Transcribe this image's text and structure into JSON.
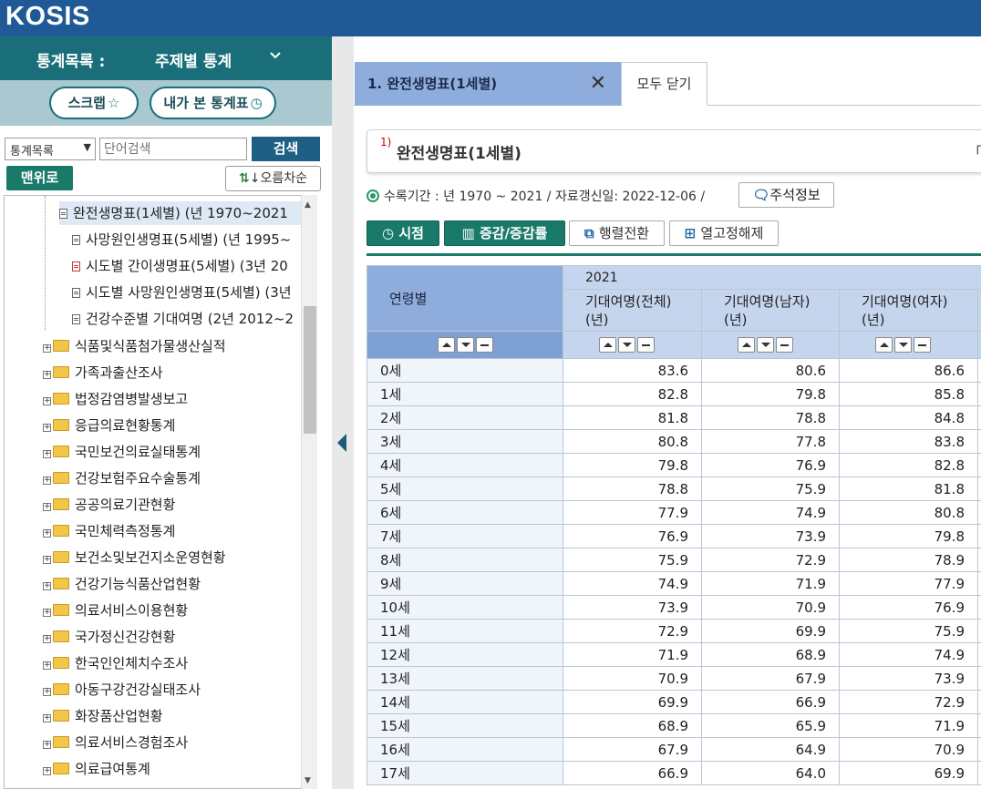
{
  "header": {
    "logo": "KOSIS"
  },
  "sidebar": {
    "catalog_label": "통계목록 :",
    "catalog_value": "주제별 통계",
    "scrap_label": "스크랩",
    "history_label": "내가 본 통계표",
    "search": {
      "select_value": "통계목록",
      "placeholder": "단어검색",
      "button": "검색"
    },
    "top_button": "맨위로",
    "sort_button": "↓오름차순",
    "tables": [
      {
        "label": "완전생명표(1세별) (년 1970~2021"
      },
      {
        "label": "사망원인생명표(5세별) (년 1995~"
      },
      {
        "label": "시도별 간이생명표(5세별) (3년 20"
      },
      {
        "label": "시도별 사망원인생명표(5세별) (3년"
      },
      {
        "label": "건강수준별 기대여명 (2년 2012~2"
      }
    ],
    "folders": [
      "식품및식품첨가물생산실적",
      "가족과출산조사",
      "법정감염병발생보고",
      "응급의료현황통계",
      "국민보건의료실태통계",
      "건강보험주요수술통계",
      "공공의료기관현황",
      "국민체력측정통계",
      "보건소및보건지소운영현황",
      "건강기능식품산업현황",
      "의료서비스이용현황",
      "국가정신건강현황",
      "한국인인체치수조사",
      "아동구강건강실태조사",
      "화장품산업현황",
      "의료서비스경험조사",
      "의료급여통계"
    ]
  },
  "main": {
    "tab_active": "1. 완전생명표(1세별)",
    "tab_close_all": "모두 닫기",
    "title_sup": "1)",
    "title": "완전생명표(1세별)",
    "title_right": "「상",
    "meta_text": "수록기간 : 년 1970 ~ 2021 / 자료갱신일: 2022-12-06 /",
    "note_button": "주석정보",
    "toolbar": {
      "timepoint": "시점",
      "change": "증감/증감률",
      "pivot": "행렬전환",
      "unfreeze": "열고정해제"
    },
    "table": {
      "row_header": "연령별",
      "year": "2021",
      "columns": [
        "기대여명(전체)",
        "기대여명(남자)",
        "기대여명(여자)"
      ],
      "unit": "(년)",
      "rows": [
        {
          "label": "0세",
          "values": [
            "83.6",
            "80.6",
            "86.6"
          ]
        },
        {
          "label": "1세",
          "values": [
            "82.8",
            "79.8",
            "85.8"
          ]
        },
        {
          "label": "2세",
          "values": [
            "81.8",
            "78.8",
            "84.8"
          ]
        },
        {
          "label": "3세",
          "values": [
            "80.8",
            "77.8",
            "83.8"
          ]
        },
        {
          "label": "4세",
          "values": [
            "79.8",
            "76.9",
            "82.8"
          ]
        },
        {
          "label": "5세",
          "values": [
            "78.8",
            "75.9",
            "81.8"
          ]
        },
        {
          "label": "6세",
          "values": [
            "77.9",
            "74.9",
            "80.8"
          ]
        },
        {
          "label": "7세",
          "values": [
            "76.9",
            "73.9",
            "79.8"
          ]
        },
        {
          "label": "8세",
          "values": [
            "75.9",
            "72.9",
            "78.9"
          ]
        },
        {
          "label": "9세",
          "values": [
            "74.9",
            "71.9",
            "77.9"
          ]
        },
        {
          "label": "10세",
          "values": [
            "73.9",
            "70.9",
            "76.9"
          ]
        },
        {
          "label": "11세",
          "values": [
            "72.9",
            "69.9",
            "75.9"
          ]
        },
        {
          "label": "12세",
          "values": [
            "71.9",
            "68.9",
            "74.9"
          ]
        },
        {
          "label": "13세",
          "values": [
            "70.9",
            "67.9",
            "73.9"
          ]
        },
        {
          "label": "14세",
          "values": [
            "69.9",
            "66.9",
            "72.9"
          ]
        },
        {
          "label": "15세",
          "values": [
            "68.9",
            "65.9",
            "71.9"
          ]
        },
        {
          "label": "16세",
          "values": [
            "67.9",
            "64.9",
            "70.9"
          ]
        },
        {
          "label": "17세",
          "values": [
            "66.9",
            "64.0",
            "69.9"
          ]
        }
      ]
    }
  },
  "colors": {
    "topbar": "#1f5a96",
    "sidebar_header": "#1a6e7a",
    "accent_green": "#1a7a6a",
    "table_header": "#8faddc"
  }
}
